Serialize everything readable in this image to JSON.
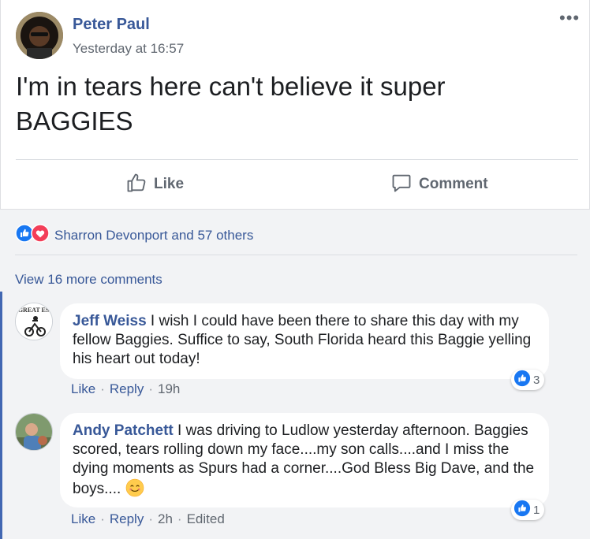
{
  "post": {
    "author": "Peter Paul",
    "time": "Yesterday at 16:57",
    "more_icon": "more-dots-icon",
    "text": "I'm in tears here can't believe it super BAGGIES",
    "actions": {
      "like_label": "Like",
      "comment_label": "Comment"
    }
  },
  "reactions": {
    "icons": [
      "like-reaction-icon",
      "love-reaction-icon"
    ],
    "text": "Sharron Devonport and 57 others"
  },
  "view_more_label": "View 16 more comments",
  "comments": [
    {
      "author": "Jeff Weiss",
      "text": "I wish I could have been there to share this day with my fellow Baggies. Suffice to say, South Florida heard this Baggie yelling his heart out today!",
      "like_label": "Like",
      "reply_label": "Reply",
      "time": "19h",
      "reaction_count": "3",
      "avatar_text": "THE GREAT ESCAPE"
    },
    {
      "author": "Andy Patchett",
      "text": "I was driving to Ludlow yesterday afternoon. Baggies scored, tears rolling down my face....my son calls....and I miss the dying moments as Spurs had a corner....God Bless Big Dave, and the boys....",
      "like_label": "Like",
      "reply_label": "Reply",
      "time": "2h",
      "edited_label": "Edited",
      "reaction_count": "1",
      "emoji": "smiling-face-emoji"
    }
  ],
  "colors": {
    "link_blue": "#385898",
    "like_blue": "#1877f2",
    "love_red": "#f33e58",
    "meta_gray": "#606770",
    "comments_bg": "#f2f3f5"
  }
}
